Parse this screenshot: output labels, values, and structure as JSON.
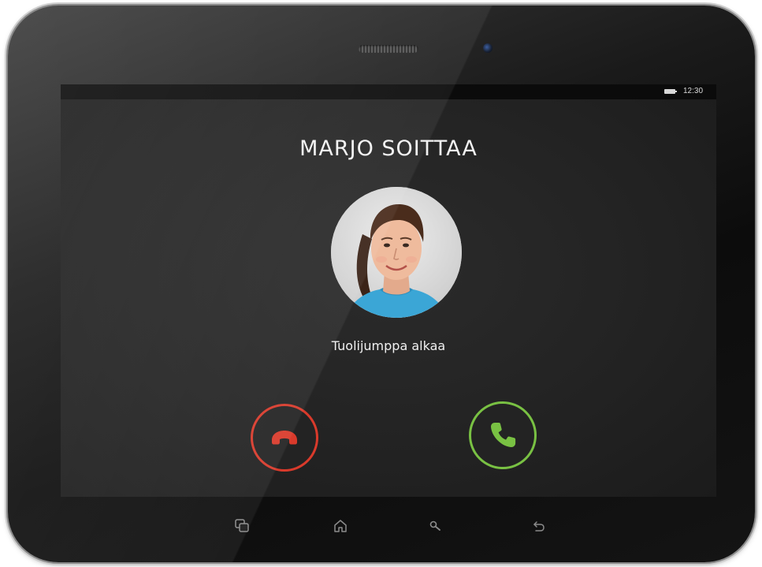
{
  "status_bar": {
    "time": "12:30",
    "battery_icon": "battery-icon"
  },
  "call": {
    "caller_title": "MARJO SOITTAA",
    "subtitle": "Tuolijumppa alkaa",
    "avatar_icon": "caller-photo"
  },
  "actions": {
    "decline_icon": "phone-hangup-icon",
    "accept_icon": "phone-answer-icon",
    "decline_color": "#d93a2b",
    "accept_color": "#79c143"
  },
  "navbar": {
    "items": [
      {
        "icon": "recent-apps-icon"
      },
      {
        "icon": "home-icon"
      },
      {
        "icon": "search-icon"
      },
      {
        "icon": "back-icon"
      }
    ]
  }
}
